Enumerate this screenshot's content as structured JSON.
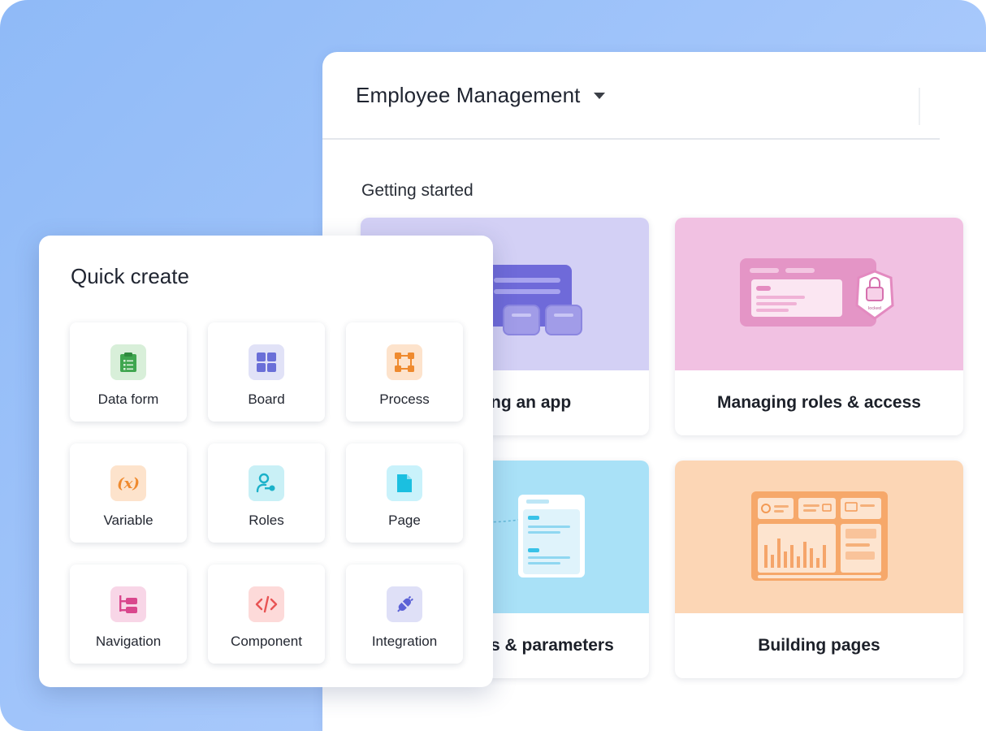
{
  "app": {
    "title": "Employee Management"
  },
  "getting_started": {
    "heading": "Getting started",
    "cards": [
      {
        "label": "ng an app"
      },
      {
        "label": "Managing roles & access"
      },
      {
        "label": "s & parameters"
      },
      {
        "label": "Building pages"
      }
    ],
    "lock_badge_text": "locked"
  },
  "quick_create": {
    "title": "Quick create",
    "items": [
      {
        "label": "Data form",
        "icon": "clipboard-list-icon",
        "color": "#3fa64f"
      },
      {
        "label": "Board",
        "icon": "grid-icon",
        "color": "#6a6fd8"
      },
      {
        "label": "Process",
        "icon": "process-flow-icon",
        "color": "#ef8a2e"
      },
      {
        "label": "Variable",
        "icon": "variable-icon",
        "color": "#ef8a2e"
      },
      {
        "label": "Roles",
        "icon": "user-key-icon",
        "color": "#1bb1c9"
      },
      {
        "label": "Page",
        "icon": "page-icon",
        "color": "#1bbfe0"
      },
      {
        "label": "Navigation",
        "icon": "navigation-tree-icon",
        "color": "#d9478d"
      },
      {
        "label": "Component",
        "icon": "code-icon",
        "color": "#e85454"
      },
      {
        "label": "Integration",
        "icon": "plug-icon",
        "color": "#5c62d6"
      }
    ]
  }
}
